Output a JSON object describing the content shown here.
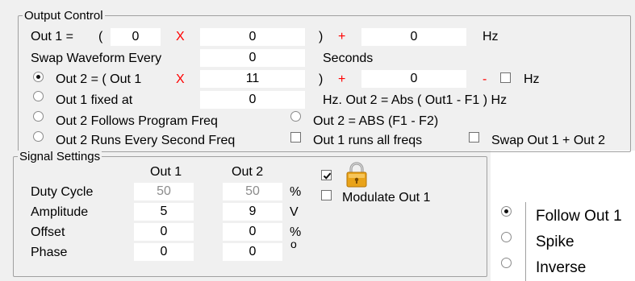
{
  "output_control": {
    "title": "Output Control",
    "out1_label": "Out 1 =",
    "open_paren": "(",
    "out1_mult": "0",
    "times_sign": "X",
    "out1_value": "0",
    "close_paren": ")",
    "plus_sign": "+",
    "out1_offset": "0",
    "hz_unit": "Hz",
    "swap_label": "Swap Waveform Every",
    "swap_value": "0",
    "seconds_label": "Seconds",
    "out2_label": "Out 2 = ( Out 1",
    "out2_value": "11",
    "out2_offset": "0",
    "minus_sign": "-",
    "out1_fixed_label": "Out 1 fixed at",
    "out1_fixed_value": "0",
    "hz_abs_label": "Hz. Out 2 = Abs ( Out1 - F1 ) Hz",
    "follows_program_label": "Out 2 Follows Program Freq",
    "abs_f1f2_label": "Out 2 = ABS (F1 - F2)",
    "runs_every_second_label": "Out 2 Runs Every Second Freq",
    "out1_all_freqs_label": "Out 1 runs all freqs",
    "swap_out_label": "Swap Out 1 + Out 2",
    "selected_mode": "out2_equals"
  },
  "signal_settings": {
    "title": "Signal Settings",
    "col_out1": "Out 1",
    "col_out2": "Out 2",
    "rows": [
      {
        "label": "Duty Cycle",
        "out1": "50",
        "out2": "50",
        "unit": "%",
        "disabled": true
      },
      {
        "label": "Amplitude",
        "out1": "5",
        "out2": "9",
        "unit": "V",
        "disabled": false
      },
      {
        "label": "Offset",
        "out1": "0",
        "out2": "0",
        "unit": "%",
        "disabled": false
      },
      {
        "label": "Phase",
        "out1": "0",
        "out2": "0",
        "unit": "o",
        "disabled": false
      }
    ],
    "lock_checked": true,
    "lock_icon": "padlock-icon",
    "modulate_label": "Modulate Out 1",
    "modulate_checked": false
  },
  "modulation_mode": {
    "options": [
      "Follow Out 1",
      "Spike",
      "Inverse"
    ],
    "selected": "Follow Out 1"
  }
}
